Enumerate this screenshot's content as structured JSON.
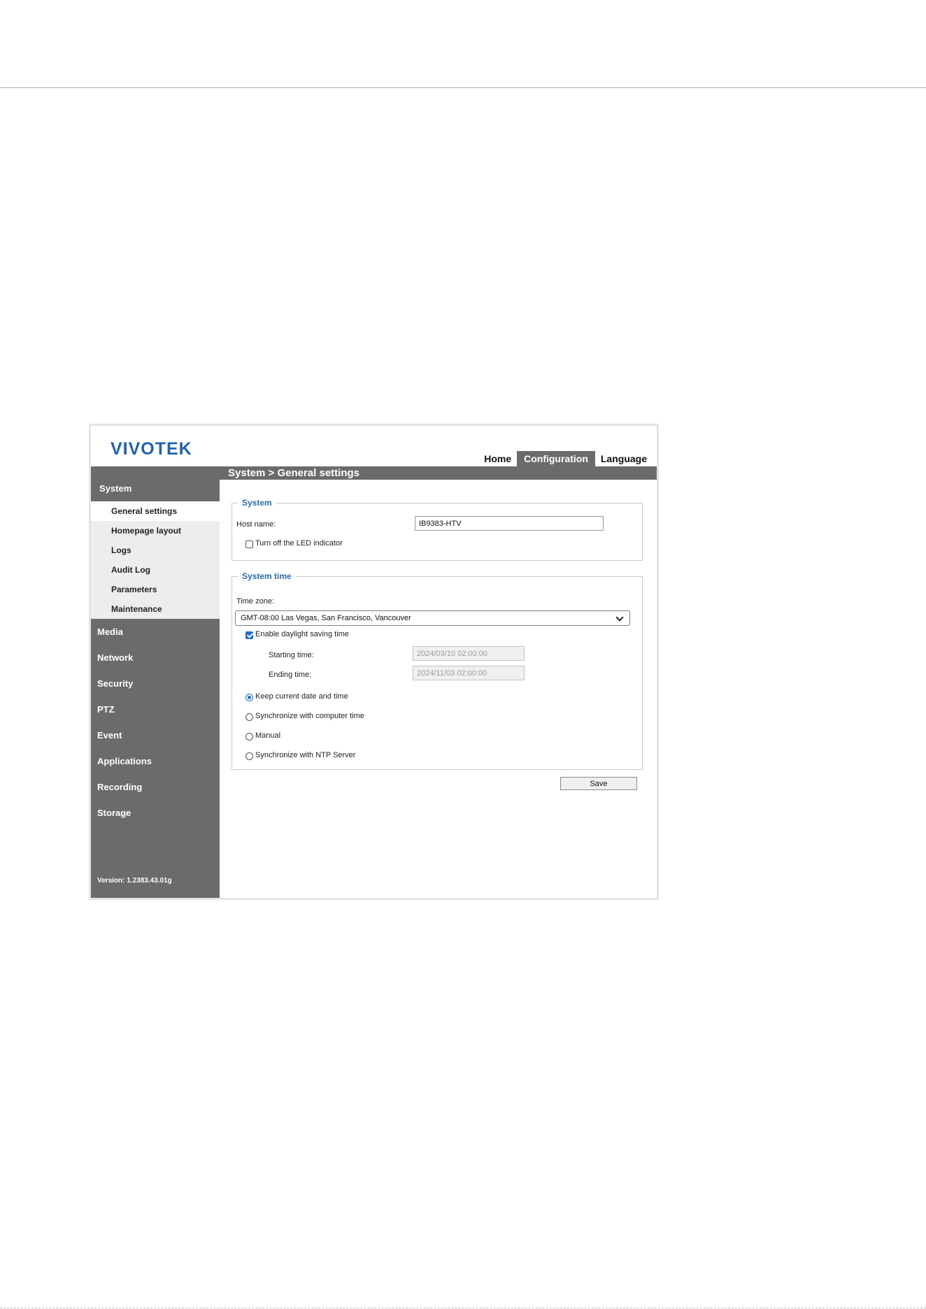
{
  "brand": {
    "logo_text": "VIVOTEK"
  },
  "topnav": {
    "home": "Home",
    "configuration": "Configuration",
    "language": "Language"
  },
  "page": {
    "title": "System  > General settings"
  },
  "sidebar": {
    "section": "System",
    "subitems": [
      "General settings",
      "Homepage layout",
      "Logs",
      "Audit Log",
      "Parameters",
      "Maintenance"
    ],
    "active_subitem": "General settings",
    "items": [
      "Media",
      "Network",
      "Security",
      "PTZ",
      "Event",
      "Applications",
      "Recording",
      "Storage"
    ],
    "version": "Version: 1.2383.43.01g"
  },
  "system": {
    "legend": "System",
    "host_name_label": "Host name:",
    "host_name_value": "IB9383-HTV",
    "led_label": "Turn off the LED indicator",
    "led_checked": false
  },
  "system_time": {
    "legend": "System time",
    "time_zone_label": "Time zone:",
    "time_zone_value": "GMT-08:00 Las Vegas, San Francisco, Vancouver",
    "dst_label": "Enable daylight saving time",
    "dst_checked": true,
    "start_label": "Starting time:",
    "start_value": "2024/03/10 02:00:00",
    "end_label": "Ending time:",
    "end_value": "2024/11/03 02:00:00",
    "options": [
      "Keep current date and time",
      "Synchronize with computer time",
      "Manual",
      "Synchronize with NTP Server"
    ],
    "selected_option": "Keep current date and time"
  },
  "buttons": {
    "save": "Save"
  },
  "colors": {
    "accent": "#1f63b3",
    "sidebar_bg": "#6b6b6b",
    "legend": "#2a6db5"
  }
}
